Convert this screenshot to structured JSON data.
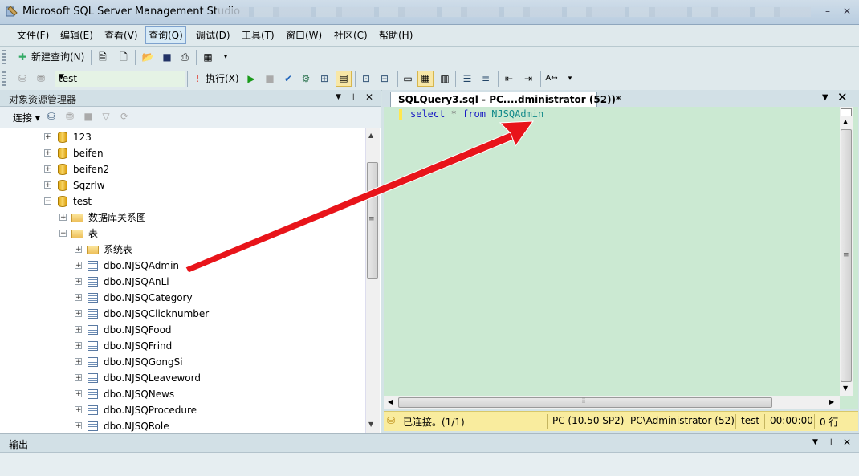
{
  "window": {
    "title": "Microsoft SQL Server Management Studio"
  },
  "menu": {
    "items": [
      "文件(F)",
      "编辑(E)",
      "查看(V)",
      "查询(Q)",
      "调试(D)",
      "工具(T)",
      "窗口(W)",
      "社区(C)",
      "帮助(H)"
    ],
    "active": "查询(Q)"
  },
  "toolbar1": {
    "new_query_label": "新建查询(N)"
  },
  "toolbar2": {
    "database_combo_value": "test",
    "execute_label": "执行(X)"
  },
  "object_explorer": {
    "title": "对象资源管理器",
    "connect_label": "连接",
    "tree": [
      {
        "label": "123",
        "type": "database",
        "level": 0,
        "expanded": false
      },
      {
        "label": "beifen",
        "type": "database",
        "level": 0,
        "expanded": false
      },
      {
        "label": "beifen2",
        "type": "database",
        "level": 0,
        "expanded": false
      },
      {
        "label": "Sqzrlw",
        "type": "database",
        "level": 0,
        "expanded": false
      },
      {
        "label": "test",
        "type": "database",
        "level": 0,
        "expanded": true
      },
      {
        "label": "数据库关系图",
        "type": "folder",
        "level": 1,
        "expanded": false
      },
      {
        "label": "表",
        "type": "folder",
        "level": 1,
        "expanded": true
      },
      {
        "label": "系统表",
        "type": "folder",
        "level": 2,
        "expanded": false
      },
      {
        "label": "dbo.NJSQAdmin",
        "type": "table",
        "level": 2,
        "expanded": false
      },
      {
        "label": "dbo.NJSQAnLi",
        "type": "table",
        "level": 2,
        "expanded": false
      },
      {
        "label": "dbo.NJSQCategory",
        "type": "table",
        "level": 2,
        "expanded": false
      },
      {
        "label": "dbo.NJSQClicknumber",
        "type": "table",
        "level": 2,
        "expanded": false
      },
      {
        "label": "dbo.NJSQFood",
        "type": "table",
        "level": 2,
        "expanded": false
      },
      {
        "label": "dbo.NJSQFrind",
        "type": "table",
        "level": 2,
        "expanded": false
      },
      {
        "label": "dbo.NJSQGongSi",
        "type": "table",
        "level": 2,
        "expanded": false
      },
      {
        "label": "dbo.NJSQLeaveword",
        "type": "table",
        "level": 2,
        "expanded": false
      },
      {
        "label": "dbo.NJSQNews",
        "type": "table",
        "level": 2,
        "expanded": false
      },
      {
        "label": "dbo.NJSQProcedure",
        "type": "table",
        "level": 2,
        "expanded": false
      },
      {
        "label": "dbo.NJSQRole",
        "type": "table",
        "level": 2,
        "expanded": false
      }
    ]
  },
  "editor": {
    "tab_title": "SQLQuery3.sql - PC....dministrator (52))*",
    "code": {
      "kw1": "select",
      "star": "*",
      "kw2": "from",
      "object": "NJSQAdmin"
    }
  },
  "status_bar": {
    "connection": "已连接。(1/1)",
    "server": "PC (10.50 SP2)",
    "user": "PC\\Administrator (52)",
    "database": "test",
    "time": "00:00:00",
    "rows": "0 行"
  },
  "output_panel": {
    "title": "输出"
  },
  "colors": {
    "editor_bg": "#cbe9d2",
    "status_bg": "#f9ec9e",
    "arrow": "#e8141a"
  }
}
